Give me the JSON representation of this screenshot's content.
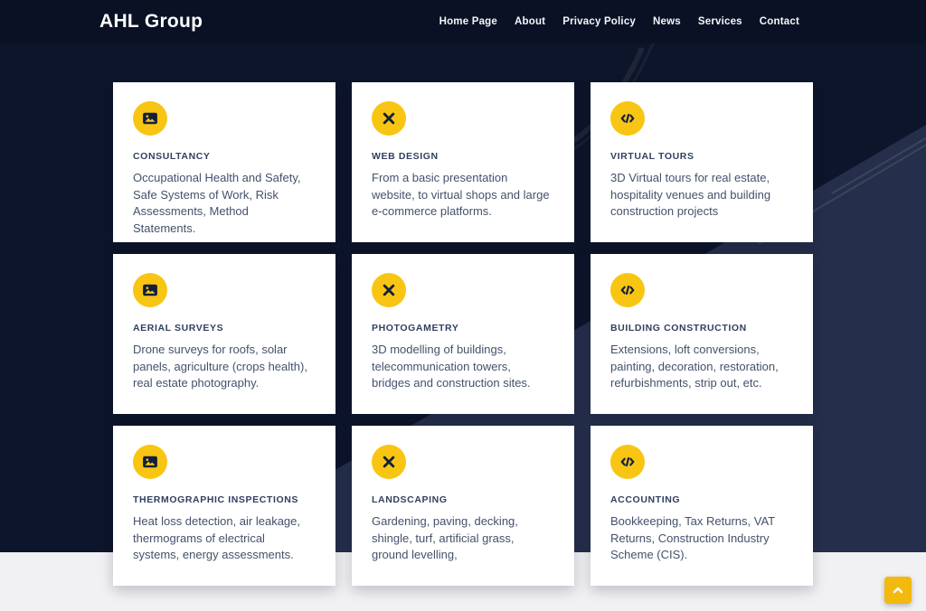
{
  "brand": "AHL Group",
  "nav": {
    "items": [
      {
        "label": "Home Page"
      },
      {
        "label": "About"
      },
      {
        "label": "Privacy Policy"
      },
      {
        "label": "News"
      },
      {
        "label": "Services"
      },
      {
        "label": "Contact"
      }
    ]
  },
  "services": {
    "cards": [
      {
        "icon": "image-icon",
        "title": "CONSULTANCY",
        "description": "Occupational Health and Safety, Safe Systems of Work, Risk Assessments, Method Statements."
      },
      {
        "icon": "design-tools-icon",
        "title": "WEB DESIGN",
        "description": "From a basic presentation website, to virtual shops and large e-commerce platforms."
      },
      {
        "icon": "code-icon",
        "title": "VIRTUAL TOURS",
        "description": "3D Virtual tours for real estate, hospitality venues and building construction projects"
      },
      {
        "icon": "image-icon",
        "title": "AERIAL SURVEYS",
        "description": "Drone surveys for roofs, solar panels, agriculture (crops health), real estate photography."
      },
      {
        "icon": "design-tools-icon",
        "title": "PHOTOGAMETRY",
        "description": "3D modelling of buildings, telecommunication towers, bridges and construction sites."
      },
      {
        "icon": "code-icon",
        "title": "BUILDING CONSTRUCTION",
        "description": "Extensions, loft conversions, painting, decoration, restoration, refurbishments, strip out, etc."
      },
      {
        "icon": "image-icon",
        "title": "THERMOGRAPHIC INSPECTIONS",
        "description": "Heat loss detection, air leakage, thermograms of electrical systems, energy assessments."
      },
      {
        "icon": "design-tools-icon",
        "title": "LANDSCAPING",
        "description": "Gardening, paving, decking, shingle, turf, artificial grass, ground levelling,"
      },
      {
        "icon": "code-icon",
        "title": "ACCOUNTING",
        "description": "Bookkeeping, Tax Returns, VAT Returns, Construction Industry Scheme (CIS)."
      }
    ]
  },
  "scroll_top": {
    "icon": "chevron-up-icon"
  },
  "colors": {
    "header_bg": "#0A1124",
    "section_bg": "#0D152B",
    "accent_yellow": "#F9C513",
    "scroll_button_yellow": "#F2B90E",
    "card_bg": "#FFFFFF",
    "card_title": "#32405F",
    "card_text": "#44516B",
    "footer_bg": "#F1F1F3"
  }
}
